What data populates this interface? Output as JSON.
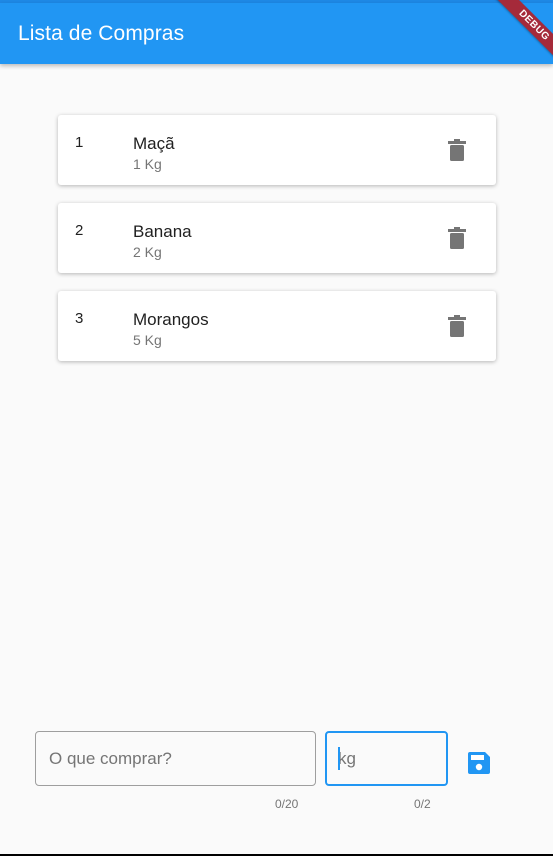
{
  "appbar": {
    "title": "Lista de Compras",
    "debug_label": "DEBUG",
    "color": "#2196f3"
  },
  "items": [
    {
      "index": "1",
      "name": "Maçã",
      "quantity": "1 Kg",
      "action_icon": "delete-icon"
    },
    {
      "index": "2",
      "name": "Banana",
      "quantity": "2 Kg",
      "action_icon": "delete-icon"
    },
    {
      "index": "3",
      "name": "Morangos",
      "quantity": "5 Kg",
      "action_icon": "delete-icon"
    }
  ],
  "form": {
    "item_placeholder": "O que comprar?",
    "item_value": "",
    "item_counter": "0/20",
    "kg_placeholder": "kg",
    "kg_value": "",
    "kg_counter": "0/2",
    "save_icon": "save-icon",
    "accent": "#2196f3"
  }
}
